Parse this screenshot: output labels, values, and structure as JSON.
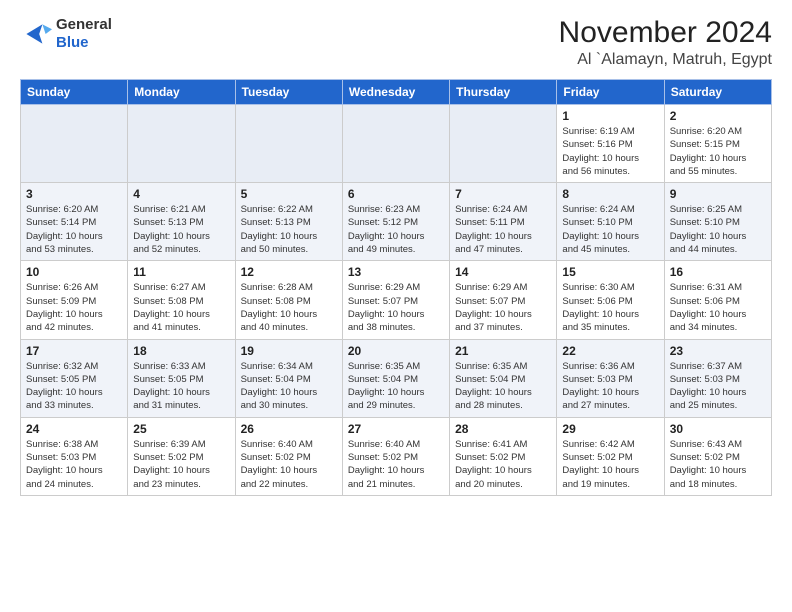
{
  "header": {
    "logo_line1": "General",
    "logo_line2": "Blue",
    "month_title": "November 2024",
    "location": "Al `Alamayn, Matruh, Egypt"
  },
  "calendar": {
    "headers": [
      "Sunday",
      "Monday",
      "Tuesday",
      "Wednesday",
      "Thursday",
      "Friday",
      "Saturday"
    ],
    "weeks": [
      [
        {
          "day": "",
          "info": ""
        },
        {
          "day": "",
          "info": ""
        },
        {
          "day": "",
          "info": ""
        },
        {
          "day": "",
          "info": ""
        },
        {
          "day": "",
          "info": ""
        },
        {
          "day": "1",
          "info": "Sunrise: 6:19 AM\nSunset: 5:16 PM\nDaylight: 10 hours\nand 56 minutes."
        },
        {
          "day": "2",
          "info": "Sunrise: 6:20 AM\nSunset: 5:15 PM\nDaylight: 10 hours\nand 55 minutes."
        }
      ],
      [
        {
          "day": "3",
          "info": "Sunrise: 6:20 AM\nSunset: 5:14 PM\nDaylight: 10 hours\nand 53 minutes."
        },
        {
          "day": "4",
          "info": "Sunrise: 6:21 AM\nSunset: 5:13 PM\nDaylight: 10 hours\nand 52 minutes."
        },
        {
          "day": "5",
          "info": "Sunrise: 6:22 AM\nSunset: 5:13 PM\nDaylight: 10 hours\nand 50 minutes."
        },
        {
          "day": "6",
          "info": "Sunrise: 6:23 AM\nSunset: 5:12 PM\nDaylight: 10 hours\nand 49 minutes."
        },
        {
          "day": "7",
          "info": "Sunrise: 6:24 AM\nSunset: 5:11 PM\nDaylight: 10 hours\nand 47 minutes."
        },
        {
          "day": "8",
          "info": "Sunrise: 6:24 AM\nSunset: 5:10 PM\nDaylight: 10 hours\nand 45 minutes."
        },
        {
          "day": "9",
          "info": "Sunrise: 6:25 AM\nSunset: 5:10 PM\nDaylight: 10 hours\nand 44 minutes."
        }
      ],
      [
        {
          "day": "10",
          "info": "Sunrise: 6:26 AM\nSunset: 5:09 PM\nDaylight: 10 hours\nand 42 minutes."
        },
        {
          "day": "11",
          "info": "Sunrise: 6:27 AM\nSunset: 5:08 PM\nDaylight: 10 hours\nand 41 minutes."
        },
        {
          "day": "12",
          "info": "Sunrise: 6:28 AM\nSunset: 5:08 PM\nDaylight: 10 hours\nand 40 minutes."
        },
        {
          "day": "13",
          "info": "Sunrise: 6:29 AM\nSunset: 5:07 PM\nDaylight: 10 hours\nand 38 minutes."
        },
        {
          "day": "14",
          "info": "Sunrise: 6:29 AM\nSunset: 5:07 PM\nDaylight: 10 hours\nand 37 minutes."
        },
        {
          "day": "15",
          "info": "Sunrise: 6:30 AM\nSunset: 5:06 PM\nDaylight: 10 hours\nand 35 minutes."
        },
        {
          "day": "16",
          "info": "Sunrise: 6:31 AM\nSunset: 5:06 PM\nDaylight: 10 hours\nand 34 minutes."
        }
      ],
      [
        {
          "day": "17",
          "info": "Sunrise: 6:32 AM\nSunset: 5:05 PM\nDaylight: 10 hours\nand 33 minutes."
        },
        {
          "day": "18",
          "info": "Sunrise: 6:33 AM\nSunset: 5:05 PM\nDaylight: 10 hours\nand 31 minutes."
        },
        {
          "day": "19",
          "info": "Sunrise: 6:34 AM\nSunset: 5:04 PM\nDaylight: 10 hours\nand 30 minutes."
        },
        {
          "day": "20",
          "info": "Sunrise: 6:35 AM\nSunset: 5:04 PM\nDaylight: 10 hours\nand 29 minutes."
        },
        {
          "day": "21",
          "info": "Sunrise: 6:35 AM\nSunset: 5:04 PM\nDaylight: 10 hours\nand 28 minutes."
        },
        {
          "day": "22",
          "info": "Sunrise: 6:36 AM\nSunset: 5:03 PM\nDaylight: 10 hours\nand 27 minutes."
        },
        {
          "day": "23",
          "info": "Sunrise: 6:37 AM\nSunset: 5:03 PM\nDaylight: 10 hours\nand 25 minutes."
        }
      ],
      [
        {
          "day": "24",
          "info": "Sunrise: 6:38 AM\nSunset: 5:03 PM\nDaylight: 10 hours\nand 24 minutes."
        },
        {
          "day": "25",
          "info": "Sunrise: 6:39 AM\nSunset: 5:02 PM\nDaylight: 10 hours\nand 23 minutes."
        },
        {
          "day": "26",
          "info": "Sunrise: 6:40 AM\nSunset: 5:02 PM\nDaylight: 10 hours\nand 22 minutes."
        },
        {
          "day": "27",
          "info": "Sunrise: 6:40 AM\nSunset: 5:02 PM\nDaylight: 10 hours\nand 21 minutes."
        },
        {
          "day": "28",
          "info": "Sunrise: 6:41 AM\nSunset: 5:02 PM\nDaylight: 10 hours\nand 20 minutes."
        },
        {
          "day": "29",
          "info": "Sunrise: 6:42 AM\nSunset: 5:02 PM\nDaylight: 10 hours\nand 19 minutes."
        },
        {
          "day": "30",
          "info": "Sunrise: 6:43 AM\nSunset: 5:02 PM\nDaylight: 10 hours\nand 18 minutes."
        }
      ]
    ]
  }
}
